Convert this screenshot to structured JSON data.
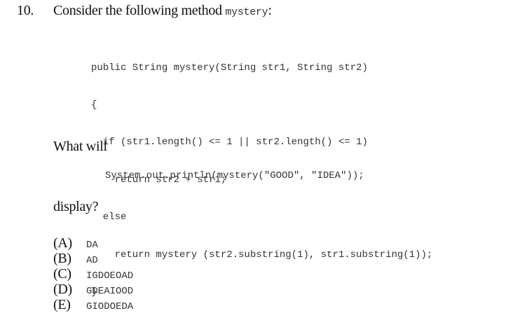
{
  "question": {
    "number": "10.",
    "prompt": "Consider the following method ",
    "method_name": "mystery",
    "prompt_end": ":",
    "code_lines": [
      "public String mystery(String str1, String str2)",
      "{",
      "  if (str1.length() <= 1 || str2.length() <= 1)",
      "    return str2 + str1;",
      "  else",
      "    return mystery (str2.substring(1), str1.substring(1));",
      "}"
    ],
    "what_will": "What will",
    "call_code": "System.out.println(mystery(\"GOOD\", \"IDEA\"));",
    "display": "display?",
    "options": [
      {
        "letter": "(A)",
        "text": "DA"
      },
      {
        "letter": "(B)",
        "text": "AD"
      },
      {
        "letter": "(C)",
        "text": "IGDOEOAD"
      },
      {
        "letter": "(D)",
        "text": "GDEAIOOD"
      },
      {
        "letter": "(E)",
        "text": "GIODOEDA"
      }
    ]
  }
}
